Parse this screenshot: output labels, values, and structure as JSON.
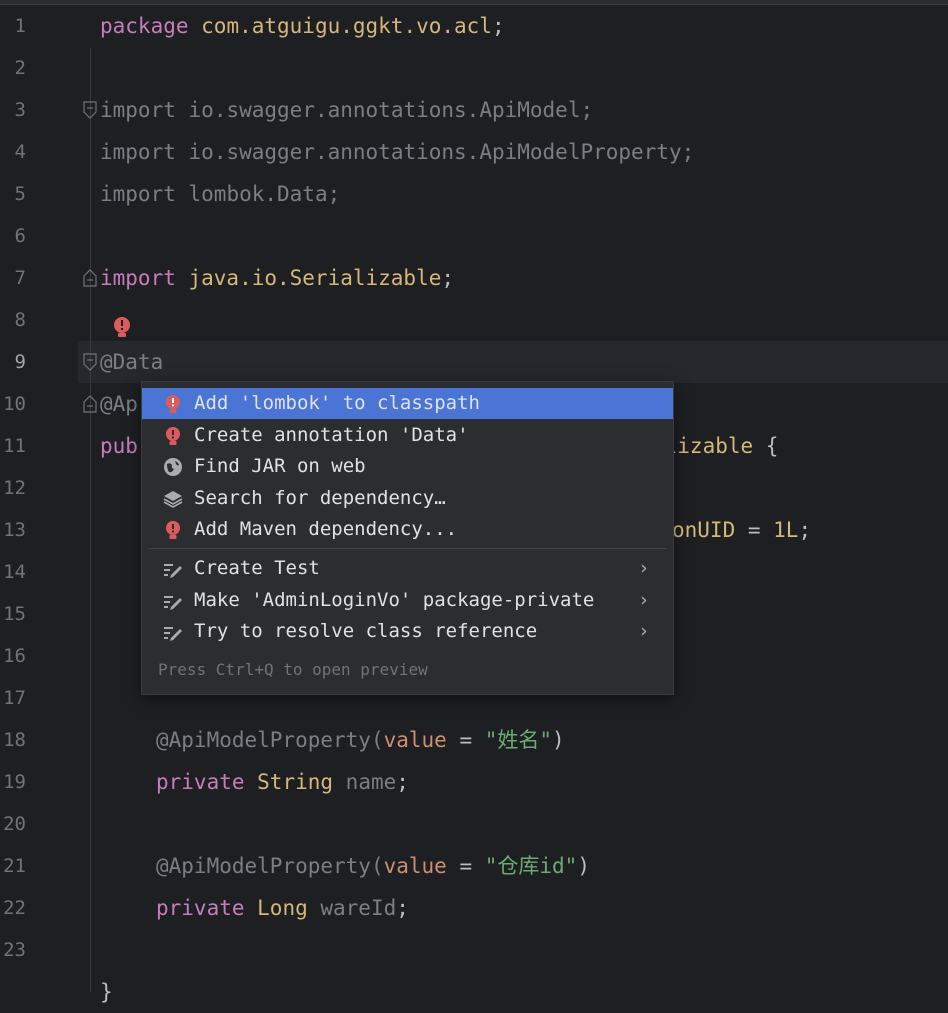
{
  "editor": {
    "line_numbers": [
      "1",
      "2",
      "3",
      "4",
      "5",
      "6",
      "7",
      "8",
      "9",
      "10",
      "11",
      "12",
      "13",
      "14",
      "15",
      "16",
      "17",
      "18",
      "19",
      "20",
      "21",
      "22",
      "23"
    ],
    "lines": {
      "l1": {
        "kw": "package",
        "pkg": " com.atguigu.ggkt.vo.acl",
        "end": ";"
      },
      "l3": {
        "kw": "import",
        "sp": " ",
        "err": "io",
        "rest": ".swagger.annotations.ApiModel;"
      },
      "l4": {
        "kw": "import",
        "sp": " ",
        "err": "io",
        "rest": ".swagger.annotations.ApiModelProperty;"
      },
      "l5": {
        "kw": "import",
        "sp": " ",
        "err": "lombok",
        "rest": ".Data;"
      },
      "l7": {
        "kw": "import",
        "pkg": " java.io.Serializable",
        "end": ";"
      },
      "l9": {
        "at": "@",
        "err": "Data"
      },
      "l10": {
        "text": "@Ap"
      },
      "l11a": {
        "text": "pub"
      },
      "l11b": {
        "pkg": "alizable",
        "end": " {"
      },
      "l13": {
        "fld": "onUID",
        "eq": " = ",
        "num": "1L",
        "end": ";"
      },
      "l18": {
        "err": "@ApiModelProperty",
        "open": "(",
        "param": "value",
        "eq": " = ",
        "str": "\"姓名\"",
        "close": ")"
      },
      "l19": {
        "kw": "private",
        "typ": " String",
        "fld": " name",
        "end": ";"
      },
      "l21": {
        "err": "@ApiModelProperty",
        "open": "(",
        "param": "value",
        "eq": " = ",
        "str": "\"仓库id\"",
        "close": ")"
      },
      "l22": {
        "kw": "private",
        "typ": " Long",
        "fld": " wareId",
        "end": ";"
      },
      "l24": {
        "text": "}"
      }
    }
  },
  "popup": {
    "items": [
      {
        "label": "Add 'lombok' to classpath",
        "icon": "error-bulb-icon"
      },
      {
        "label": "Create annotation 'Data'",
        "icon": "error-bulb-icon"
      },
      {
        "label": "Find JAR on web",
        "icon": "globe-icon"
      },
      {
        "label": "Search for dependency…",
        "icon": "layers-icon"
      },
      {
        "label": "Add Maven dependency...",
        "icon": "error-bulb-icon"
      },
      {
        "label": "Create Test",
        "icon": "edit-icon"
      },
      {
        "label": "Make 'AdminLoginVo' package-private",
        "icon": "edit-icon"
      },
      {
        "label": "Try to resolve class reference",
        "icon": "edit-icon"
      }
    ],
    "hint": "Press Ctrl+Q to open preview"
  },
  "colors": {
    "background": "#1e1f22",
    "keyword": "#cf8e6d",
    "string": "#6aab73",
    "selection": "#4a75d4",
    "error": "#e55b5b"
  }
}
